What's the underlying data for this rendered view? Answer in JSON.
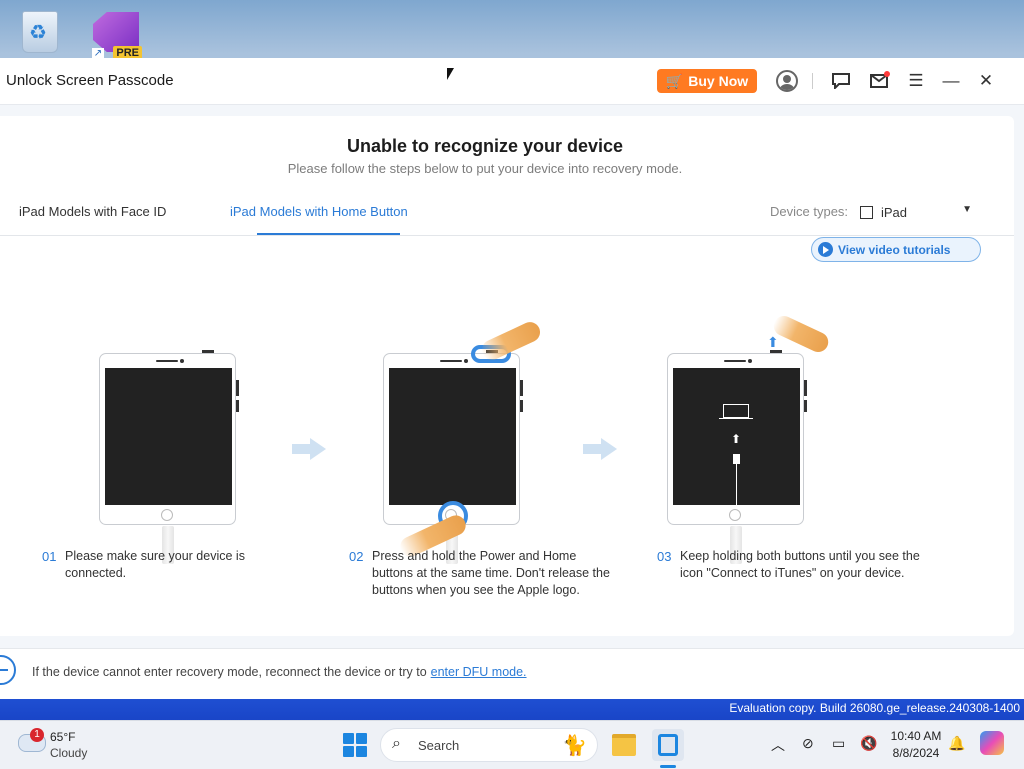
{
  "desktop": {
    "icons": [
      {
        "name": "recycle-bin"
      },
      {
        "name": "visual-studio-preview",
        "badge": "PRE"
      }
    ],
    "eval_text": "Evaluation copy. Build 26080.ge_release.240308-1400"
  },
  "app": {
    "title": "Unlock Screen Passcode",
    "buy_now": "Buy Now",
    "accent": "#2b7bd6",
    "buy_color": "#ff7a21"
  },
  "content": {
    "heading": "Unable to recognize your device",
    "subheading": "Please follow the steps below to put your device into recovery mode.",
    "tabs": [
      {
        "label": "iPad Models with Face ID",
        "active": false
      },
      {
        "label": "iPad Models with Home Button",
        "active": true
      }
    ],
    "device_types_label": "Device types:",
    "device_selected": "iPad",
    "video_button": "View video tutorials",
    "steps": [
      {
        "num": "01",
        "text": "Please make sure your device is connected."
      },
      {
        "num": "02",
        "text": "Press and hold the Power and Home buttons at the same time. Don't release the buttons when you see the Apple logo."
      },
      {
        "num": "03",
        "text": "Keep holding both buttons until you see the icon \"Connect to iTunes\" on your device."
      }
    ]
  },
  "footer": {
    "text": "If the device cannot enter recovery mode, reconnect the device or try to",
    "link": "enter DFU mode."
  },
  "taskbar": {
    "weather_temp": "65°F",
    "weather_cond": "Cloudy",
    "weather_badge": "1",
    "search_label": "Search",
    "time": "10:40 AM",
    "date": "8/8/2024"
  }
}
